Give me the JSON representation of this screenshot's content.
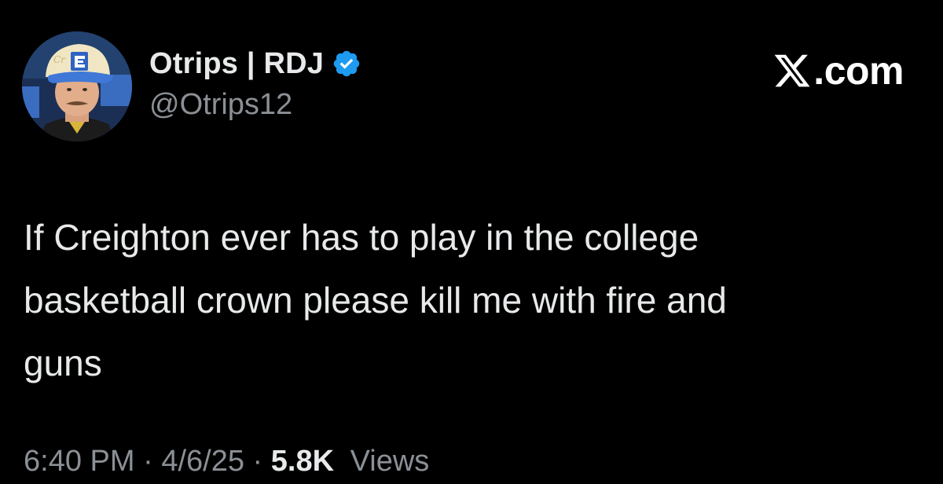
{
  "tweet": {
    "author": {
      "display_name": "Otrips | RDJ",
      "handle": "@Otrips12",
      "verified": true,
      "avatar_icon": "user-avatar-baseball-cap"
    },
    "brand": {
      "text": ".com",
      "logo_icon": "x-logo-icon"
    },
    "text_lines": [
      "If Creighton ever has to play in the college",
      "basketball crown please kill me with fire and",
      "guns"
    ],
    "meta": {
      "time": "6:40 PM",
      "separator": "·",
      "date": "4/6/25",
      "views_count": "5.8K",
      "views_label": "Views"
    }
  },
  "colors": {
    "background": "#000000",
    "primary_text": "#e7e9ea",
    "secondary_text": "#8b9096",
    "verified_badge": "#1d9bf0"
  }
}
